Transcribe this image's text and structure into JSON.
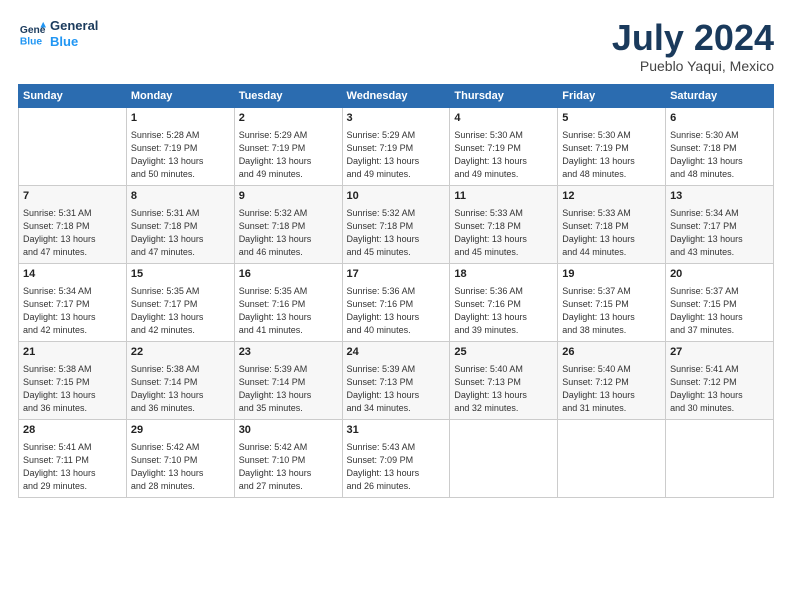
{
  "logo": {
    "line1": "General",
    "line2": "Blue"
  },
  "title": "July 2024",
  "location": "Pueblo Yaqui, Mexico",
  "days_header": [
    "Sunday",
    "Monday",
    "Tuesday",
    "Wednesday",
    "Thursday",
    "Friday",
    "Saturday"
  ],
  "weeks": [
    [
      {
        "day": "",
        "content": ""
      },
      {
        "day": "1",
        "content": "Sunrise: 5:28 AM\nSunset: 7:19 PM\nDaylight: 13 hours\nand 50 minutes."
      },
      {
        "day": "2",
        "content": "Sunrise: 5:29 AM\nSunset: 7:19 PM\nDaylight: 13 hours\nand 49 minutes."
      },
      {
        "day": "3",
        "content": "Sunrise: 5:29 AM\nSunset: 7:19 PM\nDaylight: 13 hours\nand 49 minutes."
      },
      {
        "day": "4",
        "content": "Sunrise: 5:30 AM\nSunset: 7:19 PM\nDaylight: 13 hours\nand 49 minutes."
      },
      {
        "day": "5",
        "content": "Sunrise: 5:30 AM\nSunset: 7:19 PM\nDaylight: 13 hours\nand 48 minutes."
      },
      {
        "day": "6",
        "content": "Sunrise: 5:30 AM\nSunset: 7:18 PM\nDaylight: 13 hours\nand 48 minutes."
      }
    ],
    [
      {
        "day": "7",
        "content": "Sunrise: 5:31 AM\nSunset: 7:18 PM\nDaylight: 13 hours\nand 47 minutes."
      },
      {
        "day": "8",
        "content": "Sunrise: 5:31 AM\nSunset: 7:18 PM\nDaylight: 13 hours\nand 47 minutes."
      },
      {
        "day": "9",
        "content": "Sunrise: 5:32 AM\nSunset: 7:18 PM\nDaylight: 13 hours\nand 46 minutes."
      },
      {
        "day": "10",
        "content": "Sunrise: 5:32 AM\nSunset: 7:18 PM\nDaylight: 13 hours\nand 45 minutes."
      },
      {
        "day": "11",
        "content": "Sunrise: 5:33 AM\nSunset: 7:18 PM\nDaylight: 13 hours\nand 45 minutes."
      },
      {
        "day": "12",
        "content": "Sunrise: 5:33 AM\nSunset: 7:18 PM\nDaylight: 13 hours\nand 44 minutes."
      },
      {
        "day": "13",
        "content": "Sunrise: 5:34 AM\nSunset: 7:17 PM\nDaylight: 13 hours\nand 43 minutes."
      }
    ],
    [
      {
        "day": "14",
        "content": "Sunrise: 5:34 AM\nSunset: 7:17 PM\nDaylight: 13 hours\nand 42 minutes."
      },
      {
        "day": "15",
        "content": "Sunrise: 5:35 AM\nSunset: 7:17 PM\nDaylight: 13 hours\nand 42 minutes."
      },
      {
        "day": "16",
        "content": "Sunrise: 5:35 AM\nSunset: 7:16 PM\nDaylight: 13 hours\nand 41 minutes."
      },
      {
        "day": "17",
        "content": "Sunrise: 5:36 AM\nSunset: 7:16 PM\nDaylight: 13 hours\nand 40 minutes."
      },
      {
        "day": "18",
        "content": "Sunrise: 5:36 AM\nSunset: 7:16 PM\nDaylight: 13 hours\nand 39 minutes."
      },
      {
        "day": "19",
        "content": "Sunrise: 5:37 AM\nSunset: 7:15 PM\nDaylight: 13 hours\nand 38 minutes."
      },
      {
        "day": "20",
        "content": "Sunrise: 5:37 AM\nSunset: 7:15 PM\nDaylight: 13 hours\nand 37 minutes."
      }
    ],
    [
      {
        "day": "21",
        "content": "Sunrise: 5:38 AM\nSunset: 7:15 PM\nDaylight: 13 hours\nand 36 minutes."
      },
      {
        "day": "22",
        "content": "Sunrise: 5:38 AM\nSunset: 7:14 PM\nDaylight: 13 hours\nand 36 minutes."
      },
      {
        "day": "23",
        "content": "Sunrise: 5:39 AM\nSunset: 7:14 PM\nDaylight: 13 hours\nand 35 minutes."
      },
      {
        "day": "24",
        "content": "Sunrise: 5:39 AM\nSunset: 7:13 PM\nDaylight: 13 hours\nand 34 minutes."
      },
      {
        "day": "25",
        "content": "Sunrise: 5:40 AM\nSunset: 7:13 PM\nDaylight: 13 hours\nand 32 minutes."
      },
      {
        "day": "26",
        "content": "Sunrise: 5:40 AM\nSunset: 7:12 PM\nDaylight: 13 hours\nand 31 minutes."
      },
      {
        "day": "27",
        "content": "Sunrise: 5:41 AM\nSunset: 7:12 PM\nDaylight: 13 hours\nand 30 minutes."
      }
    ],
    [
      {
        "day": "28",
        "content": "Sunrise: 5:41 AM\nSunset: 7:11 PM\nDaylight: 13 hours\nand 29 minutes."
      },
      {
        "day": "29",
        "content": "Sunrise: 5:42 AM\nSunset: 7:10 PM\nDaylight: 13 hours\nand 28 minutes."
      },
      {
        "day": "30",
        "content": "Sunrise: 5:42 AM\nSunset: 7:10 PM\nDaylight: 13 hours\nand 27 minutes."
      },
      {
        "day": "31",
        "content": "Sunrise: 5:43 AM\nSunset: 7:09 PM\nDaylight: 13 hours\nand 26 minutes."
      },
      {
        "day": "",
        "content": ""
      },
      {
        "day": "",
        "content": ""
      },
      {
        "day": "",
        "content": ""
      }
    ]
  ]
}
